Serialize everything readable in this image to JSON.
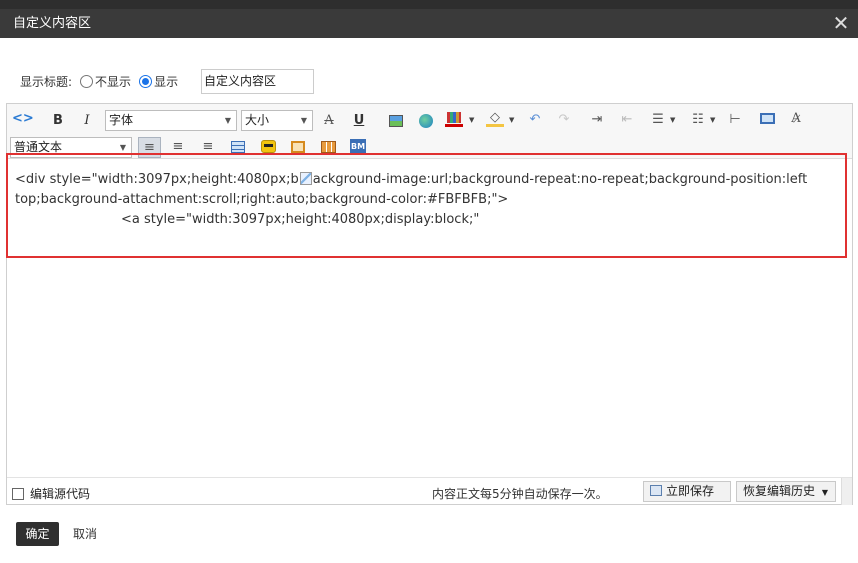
{
  "dialog": {
    "title": "自定义内容区",
    "close_icon": "close-icon"
  },
  "title_setting": {
    "label": "显示标题:",
    "options": [
      {
        "label": "不显示",
        "selected": false
      },
      {
        "label": "显示",
        "selected": true
      }
    ],
    "value": "自定义内容区"
  },
  "toolbar": {
    "font_family": "字体",
    "font_size": "大小",
    "paragraph_format": "普通文本",
    "bold": "B",
    "italic": "I",
    "strike": "A",
    "underline": "U",
    "insert_badge": "BM",
    "colors": {
      "text_color": "#cc0000",
      "highlight": "#f4c542",
      "accent": "#3b6fb6"
    }
  },
  "content": {
    "line1a": "<div style=\"width:3097px;height:4080px;b",
    "line1b": "ackground-image:url;background-repeat:no-repeat;background-position:left",
    "line2": "top;background-attachment:scroll;right:auto;background-color:#FBFBFB;\">",
    "line3": "<a style=\"width:3097px;height:4080px;display:block;\""
  },
  "bottom_bar": {
    "source_label": "编辑源代码",
    "autosave_text": "内容正文每5分钟自动保存一次。",
    "save_now": "立即保存",
    "restore": "恢复编辑历史"
  },
  "footer": {
    "ok": "确定",
    "cancel": "取消"
  }
}
